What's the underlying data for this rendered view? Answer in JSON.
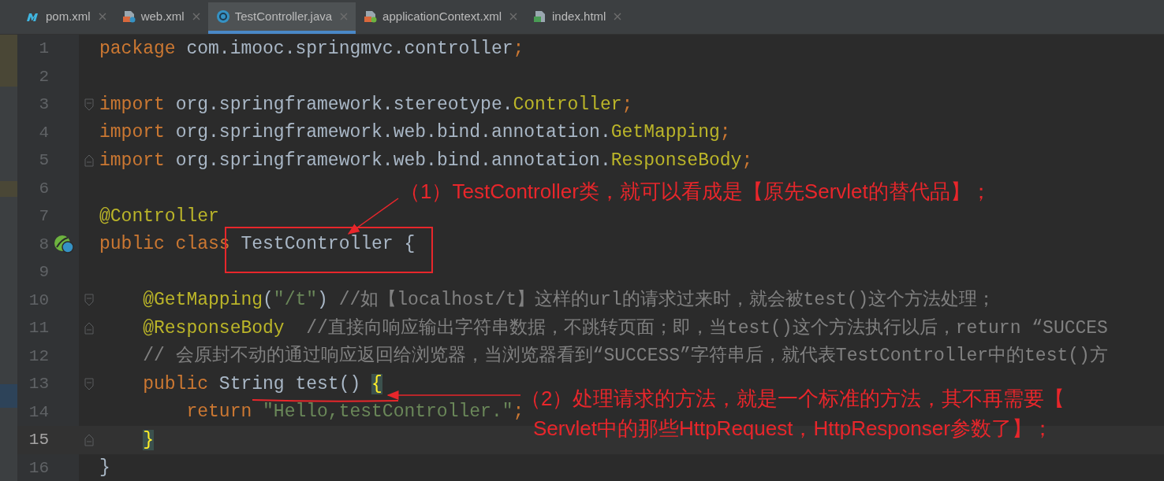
{
  "tabs": [
    {
      "label": "pom.xml",
      "selected": false
    },
    {
      "label": "web.xml",
      "selected": false
    },
    {
      "label": "TestController.java",
      "selected": true
    },
    {
      "label": "applicationContext.xml",
      "selected": false
    },
    {
      "label": "index.html",
      "selected": false
    }
  ],
  "lines": [
    {
      "number": "1",
      "current": false,
      "tokens": [
        {
          "kind": "keyword",
          "text": "package"
        },
        {
          "kind": "plain",
          "text": " com.imooc.springmvc.controller"
        },
        {
          "kind": "keyword",
          "text": ";"
        }
      ]
    },
    {
      "number": "2",
      "current": false
    },
    {
      "number": "3",
      "current": false,
      "fold_start": true,
      "tokens": [
        {
          "kind": "keyword",
          "text": "import"
        },
        {
          "kind": "plain",
          "text": " org.springframework.stereotype."
        },
        {
          "kind": "annotation",
          "text": "Controller"
        },
        {
          "kind": "keyword",
          "text": ";"
        }
      ]
    },
    {
      "number": "4",
      "current": false,
      "tokens": [
        {
          "kind": "keyword",
          "text": "import"
        },
        {
          "kind": "plain",
          "text": " org.springframework.web.bind.annotation."
        },
        {
          "kind": "annotation",
          "text": "GetMapping"
        },
        {
          "kind": "keyword",
          "text": ";"
        }
      ]
    },
    {
      "number": "5",
      "current": false,
      "fold_end": true,
      "tokens": [
        {
          "kind": "keyword",
          "text": "import"
        },
        {
          "kind": "plain",
          "text": " org.springframework.web.bind.annotation."
        },
        {
          "kind": "annotation",
          "text": "ResponseBody"
        },
        {
          "kind": "keyword",
          "text": ";"
        }
      ]
    },
    {
      "number": "6",
      "current": false
    },
    {
      "number": "7",
      "current": false,
      "tokens": [
        {
          "kind": "annotation",
          "text": "@Controller"
        }
      ]
    },
    {
      "number": "8",
      "current": false,
      "bean_icon": true,
      "tokens": [
        {
          "kind": "keyword",
          "text": "public class"
        },
        {
          "kind": "plain",
          "text": " TestController {"
        }
      ]
    },
    {
      "number": "9",
      "current": false
    },
    {
      "number": "10",
      "current": false,
      "fold_start": true,
      "tokens": [
        {
          "kind": "annotation",
          "text": "    @GetMapping"
        },
        {
          "kind": "plain",
          "text": "("
        },
        {
          "kind": "string",
          "text": "\"/t\""
        },
        {
          "kind": "plain",
          "text": ") "
        },
        {
          "kind": "comment",
          "text": "//如【localhost/t】这样的url的请求过来时，就会被test()这个方法处理；"
        }
      ]
    },
    {
      "number": "11",
      "current": false,
      "fold_end": true,
      "tokens": [
        {
          "kind": "annotation",
          "text": "    @ResponseBody"
        },
        {
          "kind": "comment",
          "text": "  //直接向响应输出字符串数据，不跳转页面；即，当test()这个方法执行以后，return “SUCCES"
        }
      ]
    },
    {
      "number": "12",
      "current": false,
      "tokens": [
        {
          "kind": "comment",
          "text": "    // 会原封不动的通过响应返回给浏览器，当浏览器看到“SUCCESS”字符串后，就代表TestController中的test()方"
        }
      ]
    },
    {
      "number": "13",
      "current": false,
      "fold_start": true,
      "tokens": [
        {
          "kind": "keyword",
          "text": "    public"
        },
        {
          "kind": "plain",
          "text": " String test() "
        },
        {
          "kind": "matched-brace",
          "text": "{"
        }
      ]
    },
    {
      "number": "14",
      "current": false,
      "tokens": [
        {
          "kind": "keyword",
          "text": "        return"
        },
        {
          "kind": "string",
          "text": " \"Hello,testController.\""
        },
        {
          "kind": "keyword",
          "text": ";"
        }
      ]
    },
    {
      "number": "15",
      "current": true,
      "fold_end": true,
      "tokens": [
        {
          "kind": "matched-brace",
          "text": "    }"
        }
      ]
    },
    {
      "number": "16",
      "current": false,
      "tokens": [
        {
          "kind": "plain",
          "text": "}"
        }
      ]
    }
  ],
  "callouts": [
    {
      "lines": [
        "（1）TestController类，就可以看成是【原先Servlet的替代品】；"
      ]
    },
    {
      "lines": [
        "（2）处理请求的方法，就是一个标准的方法，其不再需要【",
        "Servlet中的那些HttpRequest，HttpResponser参数了】；"
      ]
    }
  ]
}
